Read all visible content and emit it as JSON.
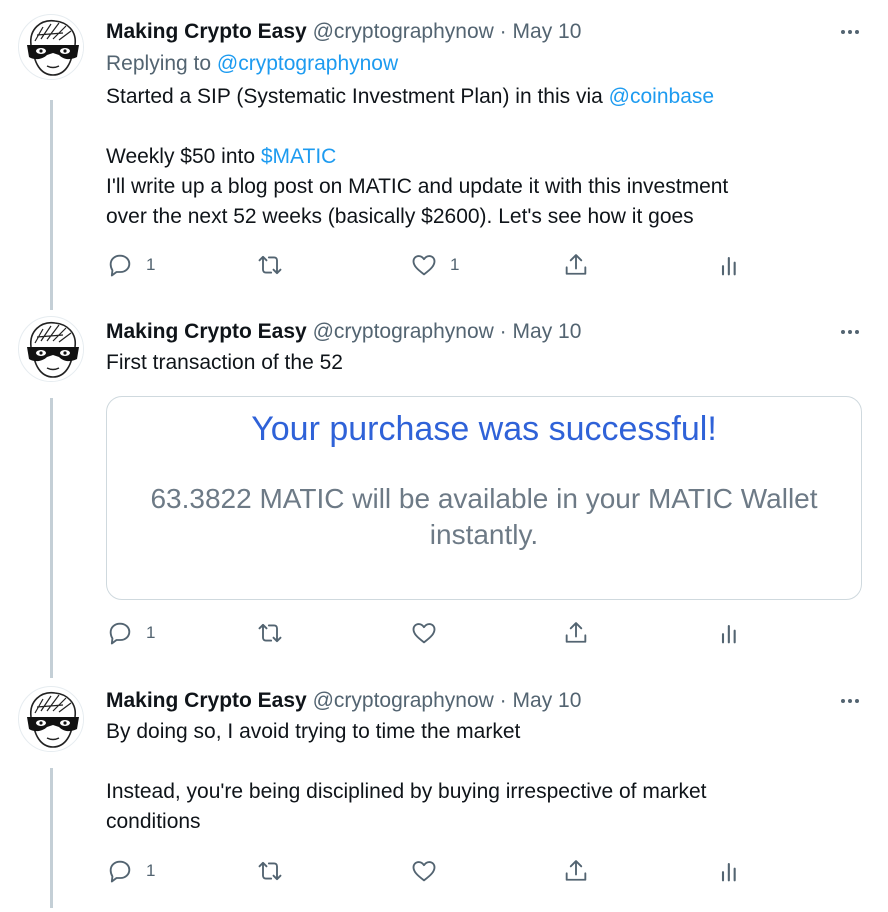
{
  "tweets": [
    {
      "name": "Making Crypto Easy",
      "handle": "@cryptographynow",
      "separator": "·",
      "date": "May 10",
      "replying_label": "Replying to",
      "replying_handle": "@cryptographynow",
      "line1_text": "Started a SIP (Systematic Investment Plan) in this via",
      "line1_mention": "@coinbase",
      "line2_text": "Weekly $50 into",
      "line2_cashtag": "$MATIC",
      "line3": "I'll write up a blog post on MATIC and update it with this investment",
      "line4": "over the next 52 weeks (basically $2600). Let's see how it goes",
      "reply_count": "1",
      "retweet_count": "",
      "like_count": "1"
    },
    {
      "name": "Making Crypto Easy",
      "handle": "@cryptographynow",
      "separator": "·",
      "date": "May 10",
      "text": "First transaction of the 52",
      "card_title": "Your purchase was successful!",
      "card_line1": "63.3822 MATIC will be available in your MATIC Wallet",
      "card_line2": "instantly.",
      "reply_count": "1",
      "retweet_count": "",
      "like_count": ""
    },
    {
      "name": "Making Crypto Easy",
      "handle": "@cryptographynow",
      "separator": "·",
      "date": "May 10",
      "line1": "By doing so, I avoid trying to time the market",
      "line2": "Instead, you're being disciplined by buying irrespective of market",
      "line3": "conditions",
      "reply_count": "1",
      "retweet_count": "",
      "like_count": ""
    }
  ],
  "icons": {
    "reply": "reply-icon",
    "retweet": "retweet-icon",
    "like": "like-icon",
    "share": "share-icon",
    "analytics": "analytics-icon",
    "more": "more-icon"
  },
  "colors": {
    "link": "#1d9bf0",
    "secondary_text": "#536471",
    "card_title": "#2f62d8",
    "thread_line": "#c4cfd6"
  }
}
